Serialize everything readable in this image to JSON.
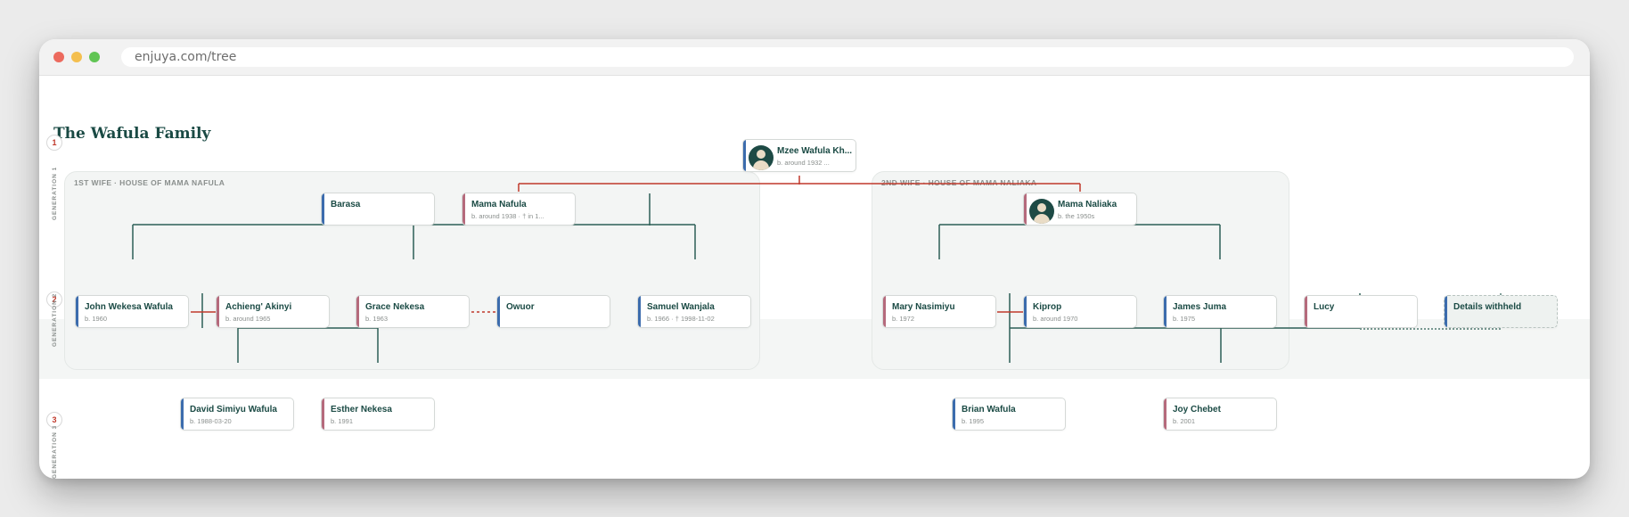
{
  "browser": {
    "url": "enjuya.com/tree"
  },
  "page": {
    "title": "The Wafula Family"
  },
  "generations": [
    {
      "number": "1",
      "label": "GENERATION 1"
    },
    {
      "number": "2",
      "label": "GENERATION 2"
    },
    {
      "number": "3",
      "label": "GENERATION 3"
    }
  ],
  "houses": [
    {
      "label": "1ST WIFE · HOUSE OF MAMA NAFULA"
    },
    {
      "label": "2ND WIFE · HOUSE OF MAMA NALIAKA"
    }
  ],
  "people": {
    "mzee": {
      "name": "Mzee Wafula Kh...",
      "dates": "b. around 1932 ...",
      "sex": "male",
      "avatar": true
    },
    "barasa": {
      "name": "Barasa",
      "dates": "",
      "sex": "male"
    },
    "mama_nafula": {
      "name": "Mama Nafula",
      "dates": "b. around 1938 · † in 1...",
      "sex": "female"
    },
    "mama_naliaka": {
      "name": "Mama Naliaka",
      "dates": "b. the 1950s",
      "sex": "female",
      "avatar": true
    },
    "john": {
      "name": "John Wekesa Wafula",
      "dates": "b. 1960",
      "sex": "male"
    },
    "achieng": {
      "name": "Achieng' Akinyi",
      "dates": "b. around 1965",
      "sex": "female"
    },
    "grace": {
      "name": "Grace Nekesa",
      "dates": "b. 1963",
      "sex": "female"
    },
    "owuor": {
      "name": "Owuor",
      "dates": "",
      "sex": "male"
    },
    "samuel": {
      "name": "Samuel Wanjala",
      "dates": "b. 1966 · † 1998-11-02",
      "sex": "male"
    },
    "mary": {
      "name": "Mary Nasimiyu",
      "dates": "b. 1972",
      "sex": "female"
    },
    "kiprop": {
      "name": "Kiprop",
      "dates": "b. around 1970",
      "sex": "male"
    },
    "james": {
      "name": "James Juma",
      "dates": "b. 1975",
      "sex": "male"
    },
    "lucy": {
      "name": "Lucy",
      "dates": "",
      "sex": "female"
    },
    "withheld": {
      "name": "Details withheld",
      "dates": "",
      "sex": "male"
    },
    "david": {
      "name": "David Simiyu Wafula",
      "dates": "b. 1988-03-20",
      "sex": "male"
    },
    "esther": {
      "name": "Esther Nekesa",
      "dates": "b. 1991",
      "sex": "female"
    },
    "brian": {
      "name": "Brian Wafula",
      "dates": "b. 1995",
      "sex": "male"
    },
    "joy": {
      "name": "Joy Chebet",
      "dates": "b. 2001",
      "sex": "female"
    }
  },
  "colors": {
    "accent": "#1a4a44",
    "line_green": "#2d5f56",
    "line_red": "#c0392b",
    "male": "#3c6cad",
    "female": "#b56a7c"
  }
}
